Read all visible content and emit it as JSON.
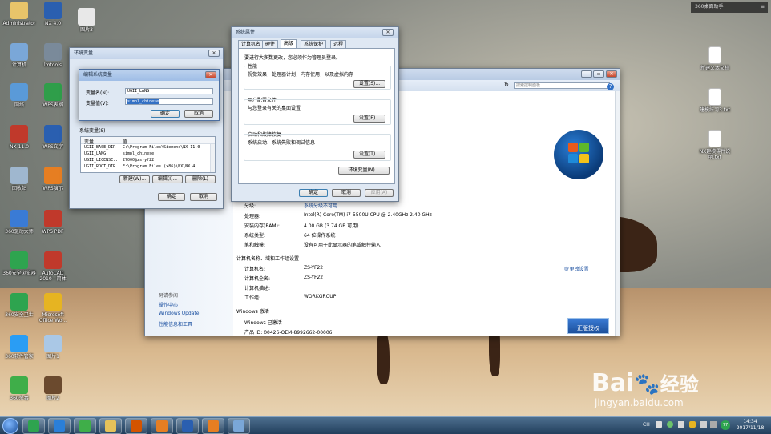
{
  "desktop": {
    "icons": [
      {
        "label": "Administrator",
        "color": "#e8c46a"
      },
      {
        "label": "NX 4.0",
        "color": "#2a5fb0"
      },
      {
        "label": "图片3",
        "color": "#e8e8e8"
      },
      {
        "label": "计算机",
        "color": "#7aa7d8"
      },
      {
        "label": "lmtools",
        "color": "#7a8a9a"
      },
      {
        "label": "网络",
        "color": "#5a9ad8"
      },
      {
        "label": "WPS表格",
        "color": "#2f9e4a"
      },
      {
        "label": "NX 11.0",
        "color": "#c0392b"
      },
      {
        "label": "WPS文字",
        "color": "#2a5fb0"
      },
      {
        "label": "回收站",
        "color": "#9fb7cf"
      },
      {
        "label": "WPS演示",
        "color": "#e67e22"
      },
      {
        "label": "360驱动大师",
        "color": "#3a7bd5"
      },
      {
        "label": "WPS PDF",
        "color": "#c0392b"
      },
      {
        "label": "360安全浏览器",
        "color": "#2ea44f"
      },
      {
        "label": "AutoCAD 2010 - 简体",
        "color": "#c0392b"
      },
      {
        "label": "360安全卫士",
        "color": "#2ea44f"
      },
      {
        "label": "Microsoft Office Wo...",
        "color": "#e6b422"
      },
      {
        "label": "360软件管家",
        "color": "#2a9df4"
      },
      {
        "label": "图片1",
        "color": "#aac8e6"
      },
      {
        "label": "360杀毒",
        "color": "#3fae49"
      },
      {
        "label": "图片2",
        "color": "#6b4a2e"
      }
    ],
    "right_icons": [
      {
        "label": "新建文本文档"
      },
      {
        "label": "建模练习3.txt"
      },
      {
        "label": "NX建模零件说明.txt"
      }
    ],
    "assistant_label": "360桌面助手"
  },
  "env_dialog": {
    "title": "环境变量",
    "system_vars_title": "系统变量(S)",
    "col_var": "变量",
    "col_val": "值",
    "rows": [
      {
        "name": "UGII_BASE_DIR",
        "value": "C:\\Program Files\\Siemens\\NX 11.0"
      },
      {
        "name": "UGII_LANG",
        "value": "simpl_chinese"
      },
      {
        "name": "UGII_LICENSE...",
        "value": "27000@zs-yf22"
      },
      {
        "name": "UGII_ROOT_DIR",
        "value": "E:\\Program Files (x86)\\NX\\NX 4..."
      }
    ],
    "btn_new": "新建(W)...",
    "btn_edit": "编辑(I)...",
    "btn_delete": "删除(L)",
    "btn_ok": "确定",
    "btn_cancel": "取消"
  },
  "edit_dialog": {
    "title": "编辑系统变量",
    "name_label": "变量名(N):",
    "name_value": "UGII_LANG",
    "value_label": "变量值(V):",
    "value_value": "simpl_chinese",
    "btn_ok": "确定",
    "btn_cancel": "取消"
  },
  "sysprops": {
    "title": "系统属性",
    "tabs": [
      "计算机名",
      "硬件",
      "高级",
      "系统保护",
      "远程"
    ],
    "admin_note": "要进行大多数更改，您必须作为管理员登录。",
    "perf_title": "性能",
    "perf_desc": "视觉效果，处理器计划，内存使用，以及虚拟内存",
    "perf_btn": "设置(S)...",
    "profile_title": "用户配置文件",
    "profile_desc": "与您登录有关的桌面设置",
    "profile_btn": "设置(E)...",
    "startup_title": "启动和故障恢复",
    "startup_desc": "系统启动、系统失败和调试信息",
    "startup_btn": "设置(T)...",
    "env_btn": "环境变量(N)...",
    "btn_ok": "确定",
    "btn_cancel": "取消",
    "btn_apply": "应用(A)"
  },
  "system_window": {
    "search_placeholder": "搜索控制面板",
    "rating_label": "分级:",
    "rating_value": "系统分级不可用",
    "cpu_label": "处理器:",
    "cpu_value": "Intel(R) Core(TM) i7-5500U CPU @ 2.40GHz   2.40 GHz",
    "ram_label": "安装内存(RAM):",
    "ram_value": "4.00 GB (3.74 GB 可用)",
    "type_label": "系统类型:",
    "type_value": "64 位操作系统",
    "pen_label": "笔和触摸:",
    "pen_value": "没有可用于此显示器的笔或触控输入",
    "section_name": "计算机名称、域和工作组设置",
    "pcname_label": "计算机名:",
    "pcname_value": "ZS-YF22",
    "fullname_label": "计算机全名:",
    "fullname_value": "ZS-YF22",
    "desc_label": "计算机描述:",
    "desc_value": "",
    "workgroup_label": "工作组:",
    "workgroup_value": "WORKGROUP",
    "change_settings": "更改设置",
    "section_activation": "Windows 激活",
    "activated": "Windows 已激活",
    "product_id": "产品 ID: 00426-OEM-8992662-00006",
    "genuine_badge": "正版授权",
    "see_also": "另请参阅",
    "link1": "操作中心",
    "link2": "Windows Update",
    "link3": "性能信息和工具"
  },
  "taskbar": {
    "time": "14:34",
    "date": "2017/11/18",
    "lang": "CH",
    "badge": "77"
  },
  "watermark": {
    "brand": "Bai",
    "brand2": "经验",
    "url": "jingyan.baidu.com"
  }
}
